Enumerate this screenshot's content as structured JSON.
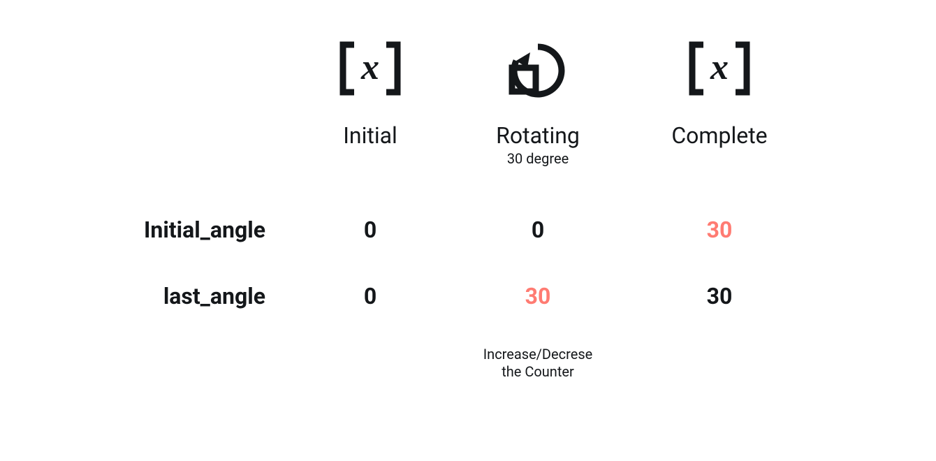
{
  "columns": {
    "initial": {
      "label": "Initial",
      "sub": ""
    },
    "rotating": {
      "label": "Rotating",
      "sub": "30 degree",
      "footer1": "Increase/Decrese",
      "footer2": "the Counter"
    },
    "complete": {
      "label": "Complete",
      "sub": ""
    }
  },
  "rows": {
    "initial_angle": {
      "label": "Initial_angle"
    },
    "last_angle": {
      "label": "last_angle"
    }
  },
  "values": {
    "initial_angle": {
      "initial": "0",
      "rotating": "0",
      "complete": "30"
    },
    "last_angle": {
      "initial": "0",
      "rotating": "30",
      "complete": "30"
    }
  },
  "highlight": {
    "initial_angle": {
      "initial": false,
      "rotating": false,
      "complete": true
    },
    "last_angle": {
      "initial": false,
      "rotating": true,
      "complete": false
    }
  },
  "icons": {
    "initial": "variable-x-bracket",
    "rotating": "rotate-ccw",
    "complete": "variable-x-bracket"
  },
  "chart_data": {
    "type": "table",
    "columns": [
      "Initial",
      "Rotating (30 degree)",
      "Complete"
    ],
    "rows": [
      {
        "name": "Initial_angle",
        "values": [
          0,
          0,
          30
        ]
      },
      {
        "name": "last_angle",
        "values": [
          0,
          30,
          30
        ]
      }
    ],
    "notes": {
      "rotating_column_footer": "Increase/Decrese the Counter"
    }
  }
}
